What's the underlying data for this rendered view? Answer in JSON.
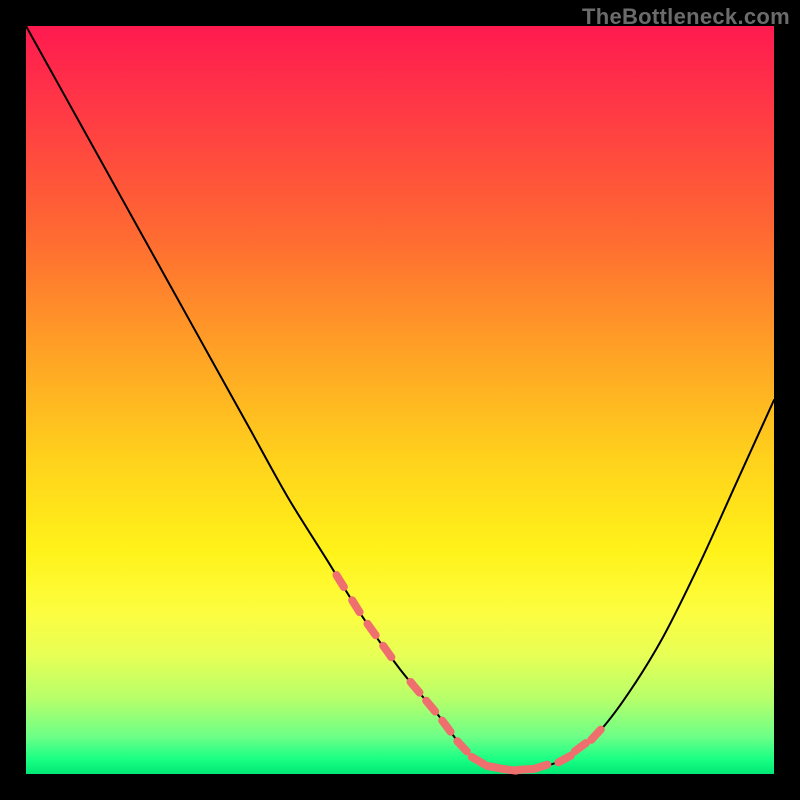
{
  "watermark": {
    "text": "TheBottleneck.com"
  },
  "chart_data": {
    "type": "line",
    "title": "",
    "xlabel": "",
    "ylabel": "",
    "xlim": [
      0,
      100
    ],
    "ylim": [
      0,
      100
    ],
    "grid": false,
    "legend": false,
    "series": [
      {
        "name": "curve",
        "x": [
          0,
          5,
          10,
          15,
          20,
          25,
          30,
          35,
          40,
          45,
          50,
          55,
          58,
          60,
          62,
          65,
          68,
          72,
          76,
          80,
          85,
          90,
          95,
          100
        ],
        "y": [
          100,
          91,
          82,
          73,
          64,
          55,
          46,
          37,
          29,
          21,
          14,
          8,
          4,
          2,
          1,
          0.5,
          0.7,
          2,
          5,
          10,
          18,
          28,
          39,
          50
        ]
      }
    ],
    "highlight_dashes_x_ranges": [
      {
        "start": 42,
        "end": 50,
        "side": "left"
      },
      {
        "start": 52,
        "end": 70,
        "side": "bottom"
      },
      {
        "start": 72,
        "end": 78,
        "side": "right"
      }
    ],
    "colors": {
      "curve": "#000000",
      "dash": "#ef6e6e",
      "gradient_top": "#ff1a50",
      "gradient_bottom": "#00e874"
    }
  }
}
